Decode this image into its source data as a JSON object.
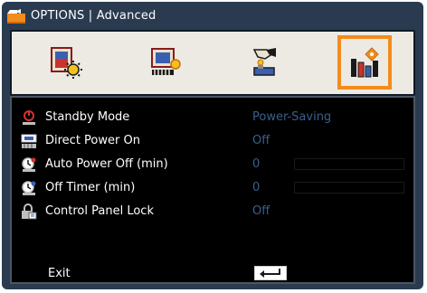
{
  "window": {
    "title": "OPTIONS | Advanced"
  },
  "tabs": [
    {
      "name": "image-settings-tab",
      "icon": "image-settings-icon",
      "active": false
    },
    {
      "name": "display-tab",
      "icon": "display-settings-icon",
      "active": false
    },
    {
      "name": "setup-tab",
      "icon": "setup-icon",
      "active": false
    },
    {
      "name": "options-tab",
      "icon": "options-icon",
      "active": true
    }
  ],
  "menu": {
    "rows": [
      {
        "label": "Standby Mode",
        "value": "Power-Saving",
        "icon": "standby-mode-icon"
      },
      {
        "label": "Direct Power On",
        "value": "Off",
        "icon": "direct-power-on-icon"
      },
      {
        "label": "Auto Power Off (min)",
        "value": "0",
        "icon": "auto-power-off-icon",
        "level": 0
      },
      {
        "label": "Off Timer (min)",
        "value": "0",
        "icon": "off-timer-icon",
        "level": 0
      },
      {
        "label": "Control Panel Lock",
        "value": "Off",
        "icon": "control-panel-lock-icon"
      }
    ],
    "exit_label": "Exit",
    "exit_icon": "enter-key-icon"
  },
  "colors": {
    "accent": "#f28c1c",
    "value_text": "#3b5f8f",
    "frame": "#2a3b50"
  }
}
